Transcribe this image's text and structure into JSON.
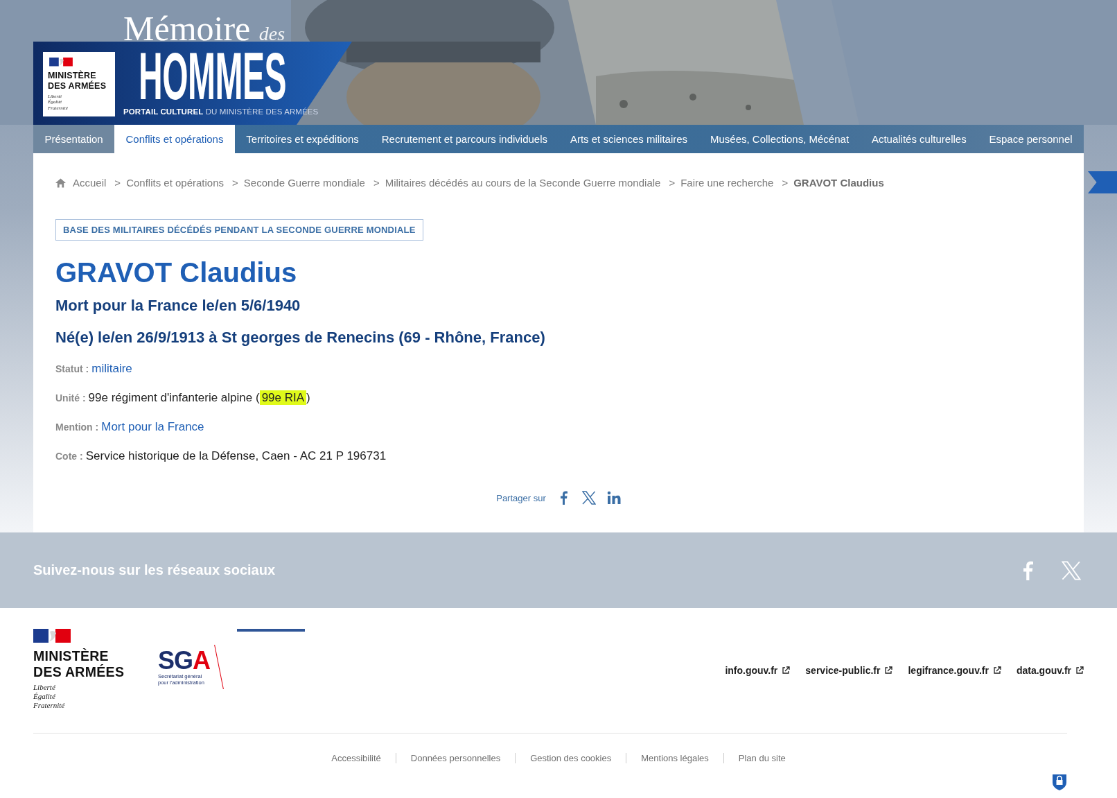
{
  "header": {
    "ministry_logo": {
      "name_lines": [
        "MINISTÈRE",
        "DES ARMÉES"
      ],
      "motto": [
        "Liberté",
        "Égalité",
        "Fraternité"
      ]
    },
    "site_title": {
      "word": "Mémoire",
      "word_small": "des",
      "main": "HOMMES",
      "tagline_bold": "PORTAIL CULTUREL",
      "tagline_rest": "DU MINISTÈRE DES ARMÉES"
    }
  },
  "nav": [
    {
      "label": "Présentation",
      "selected": false
    },
    {
      "label": "Conflits et opérations",
      "selected": true
    },
    {
      "label": "Territoires et expéditions",
      "selected": false
    },
    {
      "label": "Recrutement et parcours individuels",
      "selected": false
    },
    {
      "label": "Arts et sciences militaires",
      "selected": false
    },
    {
      "label": "Musées, Collections, Mécénat",
      "selected": false
    },
    {
      "label": "Actualités culturelles",
      "selected": false
    },
    {
      "label": "Espace personnel",
      "selected": false
    }
  ],
  "breadcrumb": {
    "separator": ">",
    "items": [
      {
        "label": "Accueil",
        "current": false
      },
      {
        "label": "Conflits et opérations",
        "current": false
      },
      {
        "label": "Seconde Guerre mondiale",
        "current": false
      },
      {
        "label": "Militaires décédés au cours de la Seconde Guerre mondiale",
        "current": false
      },
      {
        "label": "Faire une recherche",
        "current": false
      },
      {
        "label": "GRAVOT Claudius",
        "current": true
      }
    ]
  },
  "record": {
    "badge": "BASE DES MILITAIRES DÉCÉDÉS PENDANT LA SECONDE GUERRE MONDIALE",
    "name": "GRAVOT Claudius",
    "death": "Mort pour la France le/en 5/6/1940",
    "birth": "Né(e) le/en 26/9/1913 à St georges de Renecins (69 - Rhône, France)",
    "fields": [
      {
        "label": "Statut :",
        "kind": "link",
        "value": "militaire"
      },
      {
        "label": "Unité :",
        "kind": "highlighted",
        "value": "99e régiment d'infanterie alpine (",
        "highlight": "99e RIA",
        "suffix": ")"
      },
      {
        "label": "Mention :",
        "kind": "link",
        "value": "Mort pour la France"
      },
      {
        "label": "Cote :",
        "kind": "text",
        "value": "Service historique de la Défense, Caen - AC 21 P 196731"
      }
    ]
  },
  "share": {
    "label": "Partager sur"
  },
  "social_band": {
    "title": "Suivez-nous sur les réseaux sociaux"
  },
  "footer": {
    "ministry_logo": {
      "name_lines": [
        "MINISTÈRE",
        "DES ARMÉES"
      ],
      "motto": [
        "Liberté",
        "Égalité",
        "Fraternité"
      ]
    },
    "sga_logo": {
      "wordmark": "SG",
      "wordmark_accent": "A",
      "subtitle": [
        "Secrétariat général",
        "pour l'administration"
      ]
    },
    "links": [
      "info.gouv.fr",
      "service-public.fr",
      "legifrance.gouv.fr",
      "data.gouv.fr"
    ],
    "legal_links": [
      "Accessibilité",
      "Données personnelles",
      "Gestion des cookies",
      "Mentions légales",
      "Plan du site"
    ]
  }
}
